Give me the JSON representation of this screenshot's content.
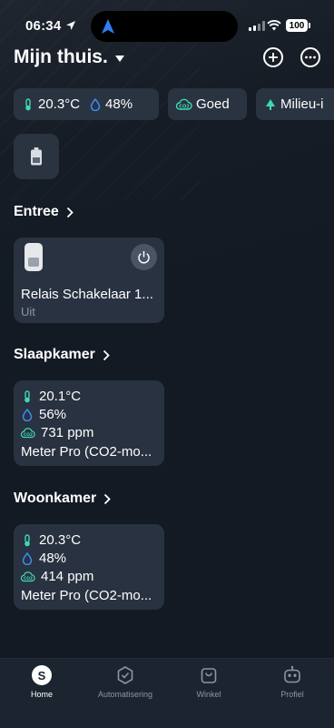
{
  "status_bar": {
    "time": "06:34",
    "battery": "100"
  },
  "header": {
    "home_name": "Mijn thuis."
  },
  "chips": {
    "temperature": "20.3°C",
    "humidity": "48%",
    "air_quality": "Goed",
    "environment": "Milieu-i"
  },
  "sections": [
    {
      "title": "Entree",
      "device": {
        "name": "Relais Schakelaar 1...",
        "state": "Uit"
      }
    },
    {
      "title": "Slaapkamer",
      "device": {
        "temperature": "20.1°C",
        "humidity": "56%",
        "co2": "731 ppm",
        "name": "Meter Pro (CO2-mo..."
      }
    },
    {
      "title": "Woonkamer",
      "device": {
        "temperature": "20.3°C",
        "humidity": "48%",
        "co2": "414 ppm",
        "name": "Meter Pro (CO2-mo..."
      }
    }
  ],
  "tabs": [
    {
      "label": "Home",
      "icon": "home-s-icon",
      "active": true
    },
    {
      "label": "Automatisering",
      "icon": "automation-icon"
    },
    {
      "label": "Winkel",
      "icon": "shop-bag-icon"
    },
    {
      "label": "Profiel",
      "icon": "robot-profile-icon"
    }
  ],
  "colors": {
    "accent": "#3ddbb0",
    "humidity": "#3a8df5",
    "background": "#131a24",
    "card": "#283240"
  }
}
